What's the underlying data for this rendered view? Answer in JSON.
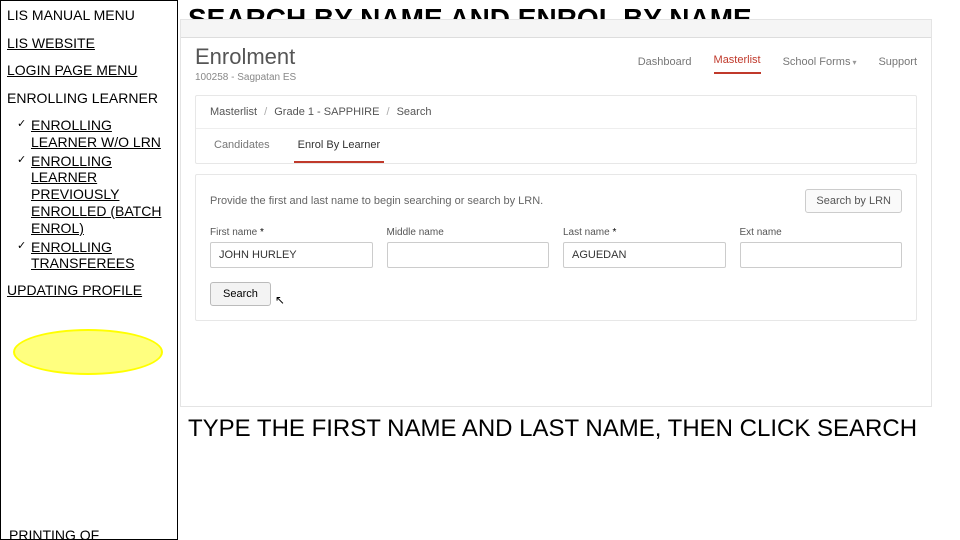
{
  "sidebar": {
    "title1": "LIS MANUAL MENU",
    "link_website": "LIS WEBSITE",
    "link_login": "LOGIN PAGE MENU",
    "heading_enroll": "ENROLLING LEARNER",
    "items": [
      "ENROLLING LEARNER W/O LRN",
      "ENROLLING LEARNER PREVIOUSLY ENROLLED (BATCH ENROL)",
      "ENROLLING TRANSFEREES"
    ],
    "link_update": "UPDATING PROFILE",
    "cutoff": "PRINTING OF"
  },
  "main": {
    "title": "SEARCH BY NAME AND ENROL BY NAME",
    "instruction": "TYPE THE FIRST NAME AND LAST NAME, THEN CLICK SEARCH"
  },
  "app": {
    "brand": "Enrolment",
    "subtitle": "100258 - Sagpatan ES",
    "nav": {
      "dashboard": "Dashboard",
      "masterlist": "Masterlist",
      "forms": "School Forms",
      "support": "Support"
    },
    "breadcrumb": {
      "a": "Masterlist",
      "b": "Grade 1 - SAPPHIRE",
      "c": "Search"
    },
    "subtabs": {
      "candidates": "Candidates",
      "enrol": "Enrol By Learner"
    },
    "search_hint": "Provide the first and last name to begin searching or search by LRN.",
    "lrn_btn": "Search by LRN",
    "labels": {
      "first": "First name",
      "middle": "Middle name",
      "last": "Last name",
      "ext": "Ext name"
    },
    "fields": {
      "first": "JOHN HURLEY",
      "middle": "",
      "last": "AGUEDAN",
      "ext": ""
    },
    "search_btn": "Search"
  }
}
